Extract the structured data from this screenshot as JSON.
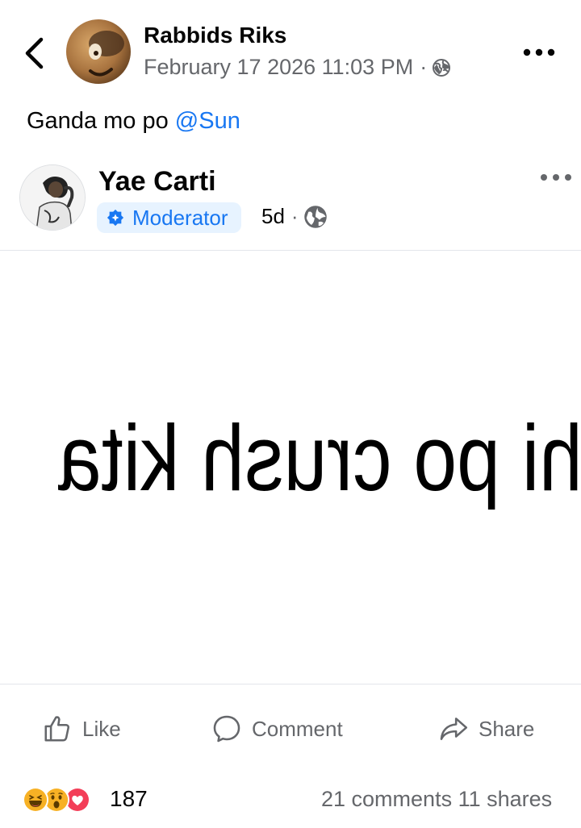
{
  "header": {
    "author_name": "Rabbids Riks",
    "timestamp": "February 17 2026 11:03 PM",
    "separator": "·",
    "privacy_icon": "globe-icon",
    "more_icon": "more-horizontal-icon",
    "back_icon": "chevron-left-icon"
  },
  "post": {
    "text": "Ganda mo po ",
    "mention": "@Sun"
  },
  "shared_post": {
    "author_name": "Yae Carti",
    "badge_label": "Moderator",
    "badge_icon": "moderator-badge-icon",
    "time": "5d",
    "separator": "·",
    "privacy_icon": "globe-icon"
  },
  "image": {
    "text": "hi po crush kita",
    "mirrored": true
  },
  "actions": {
    "like": "Like",
    "comment": "Comment",
    "share": "Share"
  },
  "stats": {
    "reactions": [
      "haha",
      "wow",
      "love"
    ],
    "reaction_count": "187",
    "comments": "21 comments",
    "shares": "11 shares"
  },
  "colors": {
    "accent": "#1877f2",
    "secondary_text": "#65676b",
    "badge_bg": "#e7f3ff",
    "divider": "#e4e6eb"
  }
}
